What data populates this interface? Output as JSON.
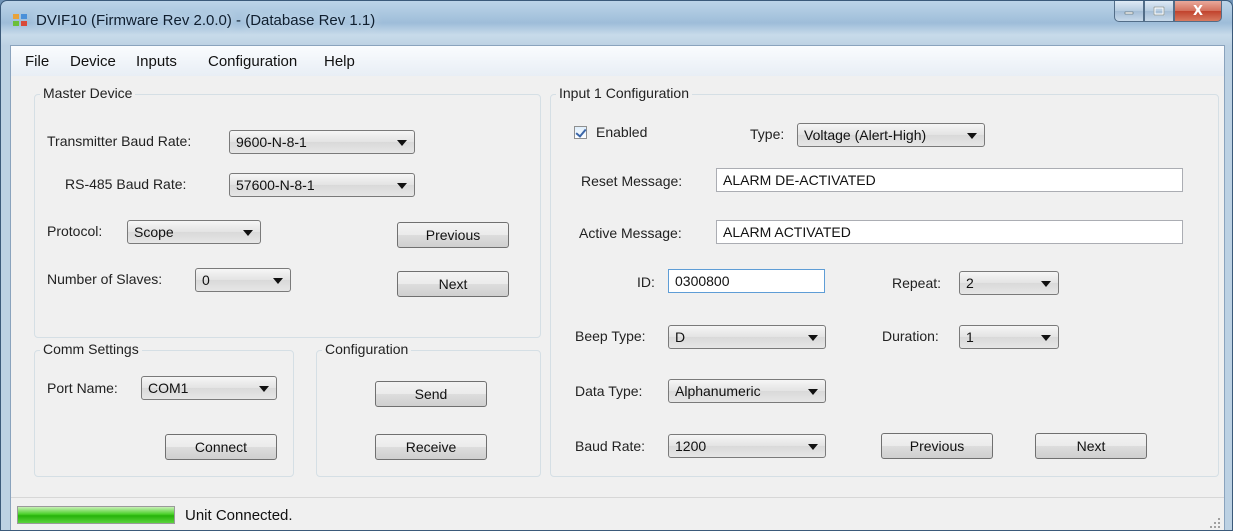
{
  "window": {
    "title": "DVIF10 (Firmware Rev 2.0.0) - (Database Rev 1.1)",
    "close_glyph": "X"
  },
  "menu": [
    "File",
    "Device",
    "Inputs",
    "Configuration",
    "Help"
  ],
  "master_device": {
    "title": "Master Device",
    "transmitter_baud_label": "Transmitter Baud Rate:",
    "transmitter_baud_value": "9600-N-8-1",
    "rs485_baud_label": "RS-485 Baud Rate:",
    "rs485_baud_value": "57600-N-8-1",
    "protocol_label": "Protocol:",
    "protocol_value": "Scope",
    "slaves_label": "Number of Slaves:",
    "slaves_value": "0",
    "previous_label": "Previous",
    "next_label": "Next"
  },
  "comm_settings": {
    "title": "Comm Settings",
    "port_label": "Port Name:",
    "port_value": "COM1",
    "connect_label": "Connect"
  },
  "configuration": {
    "title": "Configuration",
    "send_label": "Send",
    "receive_label": "Receive"
  },
  "input_config": {
    "title": "Input 1 Configuration",
    "enabled_label": "Enabled",
    "enabled_checked": true,
    "type_label": "Type:",
    "type_value": "Voltage (Alert-High)",
    "reset_label": "Reset Message:",
    "reset_value": "ALARM DE-ACTIVATED",
    "active_label": "Active Message:",
    "active_value": "ALARM ACTIVATED",
    "id_label": "ID:",
    "id_value": "0300800",
    "repeat_label": "Repeat:",
    "repeat_value": "2",
    "beep_label": "Beep Type:",
    "beep_value": "D",
    "duration_label": "Duration:",
    "duration_value": "1",
    "data_type_label": "Data Type:",
    "data_type_value": "Alphanumeric",
    "baud_label": "Baud Rate:",
    "baud_value": "1200",
    "previous_label": "Previous",
    "next_label": "Next"
  },
  "status": {
    "text": "Unit Connected.",
    "progress_fraction": 1.0,
    "progress_color": "#27b30b"
  },
  "icons": {
    "app": "app-icon",
    "minimize": "minimize-icon",
    "maximize": "maximize-icon",
    "close": "close-icon",
    "dropdown": "chevron-down-icon",
    "checkbox": "checkmark-icon",
    "grip": "resize-grip-icon"
  }
}
